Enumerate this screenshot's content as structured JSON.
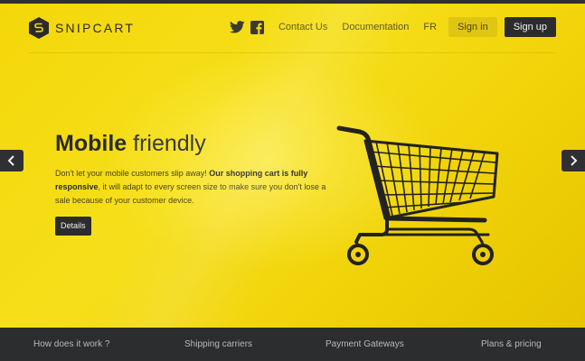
{
  "header": {
    "brand": "SNIPCART",
    "nav": {
      "contact": "Contact Us",
      "docs": "Documentation",
      "lang": "FR",
      "signin": "Sign in",
      "signup": "Sign up"
    },
    "social": [
      "twitter-icon",
      "facebook-icon"
    ]
  },
  "hero": {
    "title_strong": "Mobile",
    "title_light": "friendly",
    "desc_start": "Don't let your mobile customers slip away! ",
    "desc_bold": "Our shopping cart is fully responsive",
    "desc_end": ", it will adapt to every screen size to make sure you don't lose a sale because of your customer device.",
    "button": "Details",
    "illustration": "shopping-cart-icon"
  },
  "carousel": {
    "prev": "chevron-left-icon",
    "next": "chevron-right-icon"
  },
  "footer": {
    "links": [
      "How does it work ?",
      "Shipping carriers",
      "Payment Gateways",
      "Plans & pricing"
    ]
  },
  "colors": {
    "accent": "#f3d70a",
    "dark": "#2b2d2f"
  }
}
